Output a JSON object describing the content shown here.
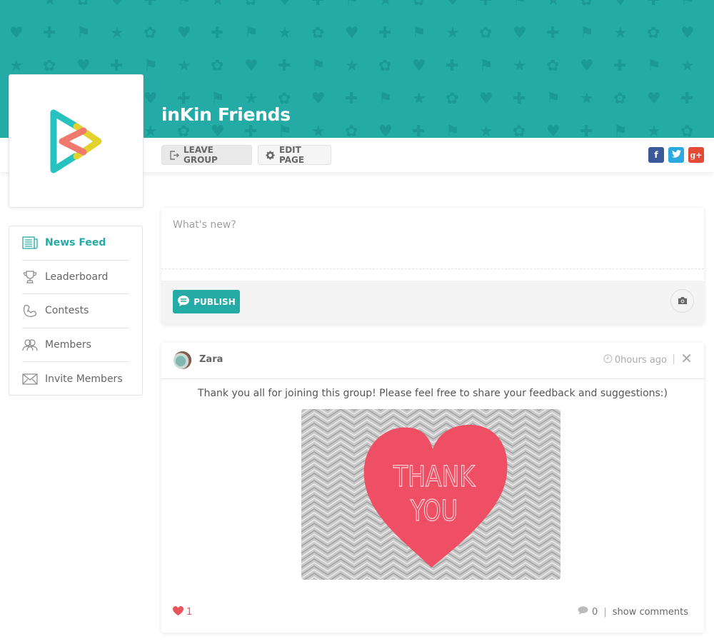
{
  "group": {
    "title": "inKin Friends",
    "brand_color": "#25aba6"
  },
  "actions": {
    "leave_label": "LEAVE GROUP",
    "edit_label": "EDIT PAGE",
    "social": [
      {
        "name": "facebook",
        "glyph": "f",
        "color": "#3b5998"
      },
      {
        "name": "twitter",
        "glyph": "t",
        "color": "#2ba9e1"
      },
      {
        "name": "google-plus",
        "glyph": "g+",
        "color": "#e34a35"
      }
    ]
  },
  "sidebar": {
    "items": [
      {
        "label": "News Feed",
        "icon": "newspaper-icon",
        "active": true
      },
      {
        "label": "Leaderboard",
        "icon": "trophy-icon",
        "active": false
      },
      {
        "label": "Contests",
        "icon": "bicep-icon",
        "active": false
      },
      {
        "label": "Members",
        "icon": "users-icon",
        "active": false
      },
      {
        "label": "Invite Members",
        "icon": "envelope-icon",
        "active": false
      }
    ]
  },
  "composer": {
    "placeholder": "What's new?",
    "value": "",
    "publish_label": "PUBLISH"
  },
  "post": {
    "author": "Zara",
    "time": "0hours ago",
    "text": "Thank you all for joining this group! Please feel free to share your feedback and suggestions:)",
    "image_text_line1": "THANK",
    "image_text_line2": "YOU",
    "likes": "1",
    "comments_count": "0",
    "show_comments_label": "show comments"
  }
}
